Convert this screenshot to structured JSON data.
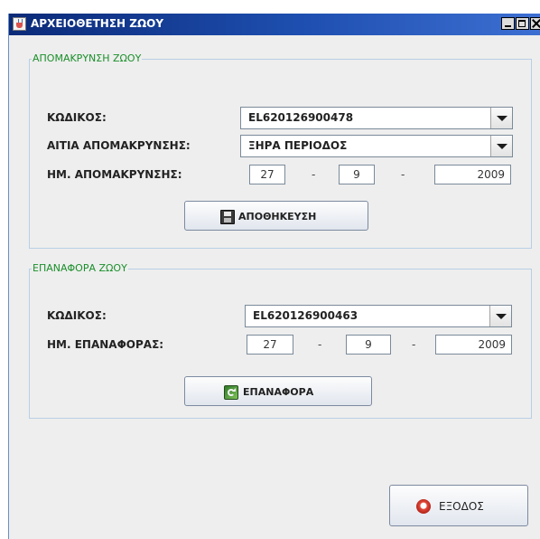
{
  "window": {
    "title": "ΑΡΧΕΙΟΘΕΤΗΣΗ ΖΩΟΥ"
  },
  "removal": {
    "group_title": "ΑΠΟΜΑΚΡΥΝΣΗ ΖΩΟΥ",
    "code_label": "ΚΩΔΙΚΟΣ:",
    "code_value": "EL620126900478",
    "reason_label": "ΑΙΤΙΑ ΑΠΟΜΑΚΡΥΝΣΗΣ:",
    "reason_value": "ΞΗΡΑ ΠΕΡΙΟΔΟΣ",
    "date_label": "ΗΜ. ΑΠΟΜΑΚΡΥΝΣΗΣ:",
    "date_day": "27",
    "date_month": "9",
    "date_year": "2009",
    "date_separator": "-",
    "save_label": "ΑΠΟΘΗΚΕΥΣΗ",
    "save_icon": "floppy-disk-icon"
  },
  "restore": {
    "group_title": "ΕΠΑΝΑΦΟΡΑ ΖΩΟΥ",
    "code_label": "ΚΩΔΙΚΟΣ:",
    "code_value": "EL620126900463",
    "date_label": "ΗΜ. ΕΠΑΝΑΦΟΡΑΣ:",
    "date_day": "27",
    "date_month": "9",
    "date_year": "2009",
    "date_separator": "-",
    "restore_label": "ΕΠΑΝΑΦΟΡΑ",
    "restore_icon": "restore-icon"
  },
  "footer": {
    "exit_label": "ΕΞΟΔΟΣ",
    "exit_icon": "exit-icon"
  },
  "colors": {
    "title_bar": "#0b2a78",
    "group_title": "#1a8f2a",
    "group_border": "#b8cfe5",
    "panel_background": "#eeeeee"
  }
}
